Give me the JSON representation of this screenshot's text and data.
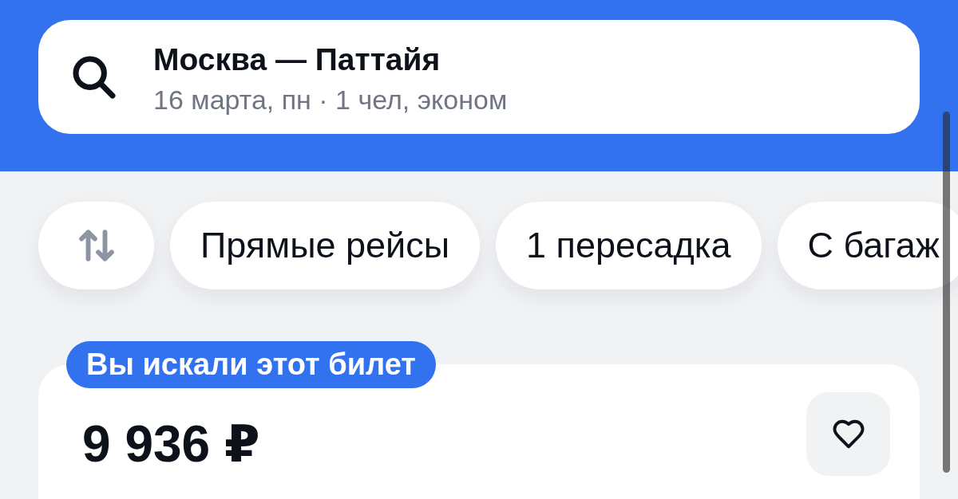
{
  "search": {
    "route": "Москва — Паттайя",
    "details": "16 марта, пн · 1 чел, эконом"
  },
  "filters": [
    {
      "kind": "sort",
      "selected": false
    },
    {
      "kind": "chip",
      "label": "Прямые рейсы",
      "selected": false
    },
    {
      "kind": "chip",
      "label": "1 пересадка",
      "selected": false
    },
    {
      "kind": "chip",
      "label": "С багаж",
      "selected": false
    }
  ],
  "ticket": {
    "badge": "Вы искали этот билет",
    "price": "9 936 ₽",
    "favorite": false
  }
}
